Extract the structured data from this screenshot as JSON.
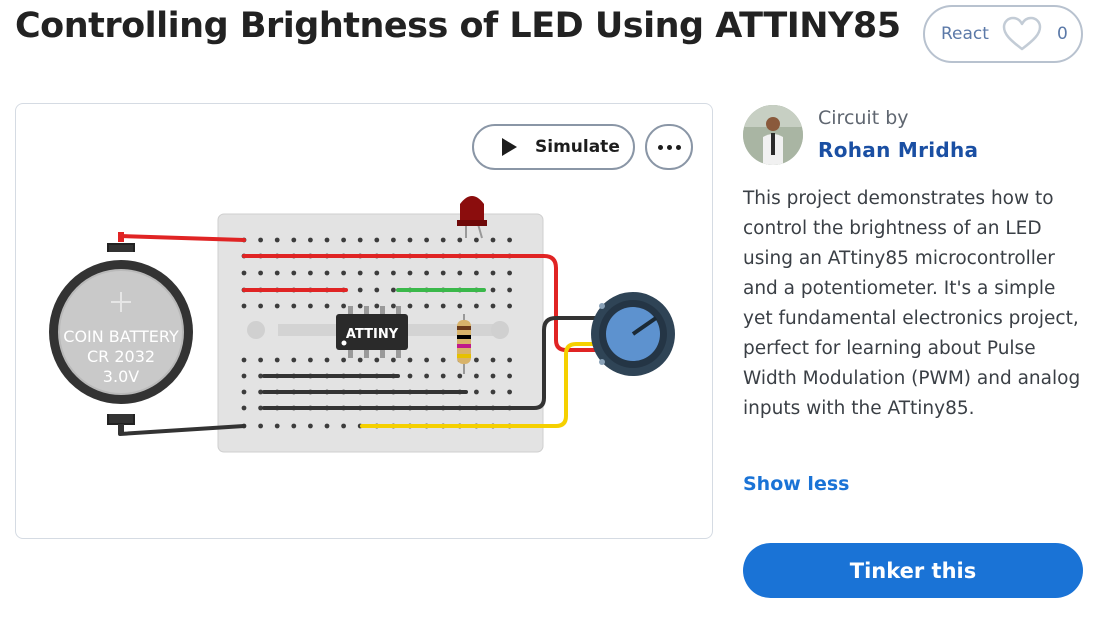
{
  "page": {
    "title": "Controlling Brightness of LED Using ATTINY85"
  },
  "react": {
    "label": "React",
    "count": "0",
    "icon": "heart-icon"
  },
  "toolbar": {
    "simulate_label": "Simulate",
    "simulate_icon": "play-icon",
    "more_icon": "more-options-icon"
  },
  "circuit": {
    "battery_lines": [
      "COIN BATTERY",
      "CR 2032",
      "3.0V"
    ],
    "chip_label": "ATTINY"
  },
  "author": {
    "by_label": "Circuit by",
    "name": "Rohan Mridha"
  },
  "description": "This project demonstrates how to control the brightness of an LED using an ATtiny85 microcontroller and a potentiometer. It's a simple yet fundamental electronics project, perfect for learning about Pulse Width Modulation (PWM) and analog inputs with the ATtiny85.",
  "show_less_label": "Show less",
  "tinker_label": "Tinker this",
  "colors": {
    "accent": "#1a73d6",
    "author_link": "#1a4fa3",
    "wire_red": "#e02424",
    "wire_black": "#333333",
    "wire_yellow": "#f5d000",
    "wire_green": "#3ab84a"
  }
}
